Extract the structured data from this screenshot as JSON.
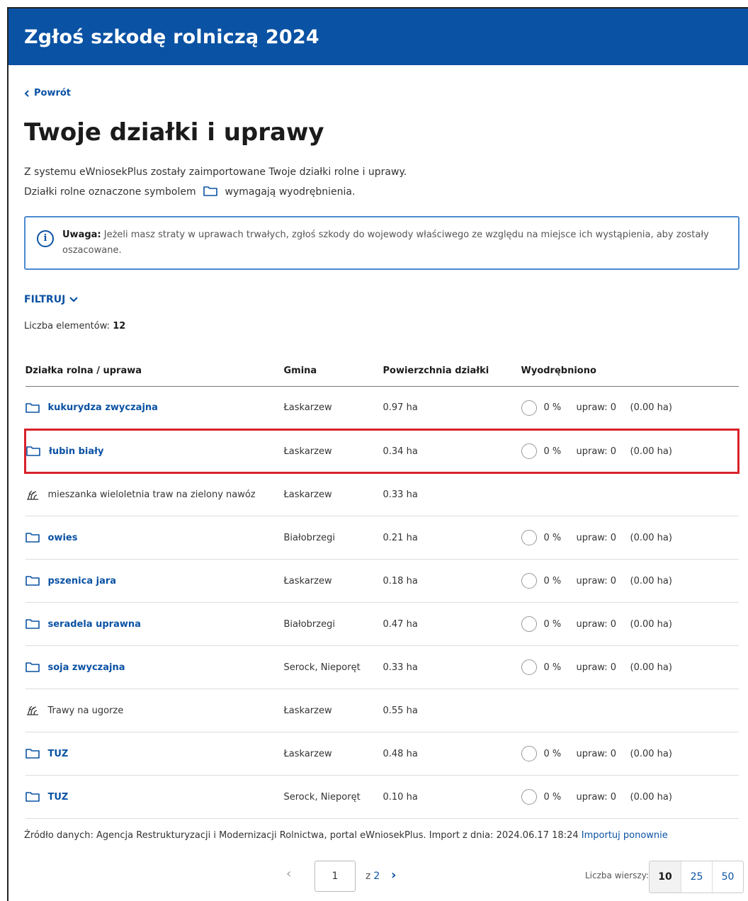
{
  "header": {
    "title": "Zgłoś szkodę rolniczą 2024"
  },
  "back": {
    "label": "Powrót"
  },
  "page_title": "Twoje działki i uprawy",
  "description": {
    "line1": "Z systemu eWniosekPlus zostały zaimportowane Twoje działki rolne i uprawy.",
    "line2_before": "Działki rolne oznaczone symbolem",
    "line2_after": "wymagają wyodrębnienia."
  },
  "alert": {
    "label": "Uwaga:",
    "text": " Jeżeli masz straty w uprawach trwałych, zgłoś szkody do wojewody właściwego ze względu na miejsce ich wystąpienia, aby zostały oszacowane."
  },
  "filter": {
    "label": "FILTRUJ"
  },
  "count": {
    "label": "Liczba elementów:",
    "value": "12"
  },
  "table": {
    "headers": [
      "Działka rolna / uprawa",
      "Gmina",
      "Powierzchnia działki",
      "Wyodrębniono"
    ],
    "rows": [
      {
        "name": "kukurydza zwyczajna",
        "gmina": "Łaskarzew",
        "area": "0.97 ha",
        "pct": "0 %",
        "upraw": "upraw: 0",
        "ha": "(0.00 ha)"
      },
      {
        "name": "łubin biały",
        "gmina": "Łaskarzew",
        "area": "0.34 ha",
        "pct": "0 %",
        "upraw": "upraw: 0",
        "ha": "(0.00 ha)"
      },
      {
        "name": "mieszanka wieloletnia traw na zielony nawóz",
        "gmina": "Łaskarzew",
        "area": "0.33 ha"
      },
      {
        "name": "owies",
        "gmina": "Białobrzegi",
        "area": "0.21 ha",
        "pct": "0 %",
        "upraw": "upraw: 0",
        "ha": "(0.00 ha)"
      },
      {
        "name": "pszenica jara",
        "gmina": "Łaskarzew",
        "area": "0.18 ha",
        "pct": "0 %",
        "upraw": "upraw: 0",
        "ha": "(0.00 ha)"
      },
      {
        "name": "seradela uprawna",
        "gmina": "Białobrzegi",
        "area": "0.47 ha",
        "pct": "0 %",
        "upraw": "upraw: 0",
        "ha": "(0.00 ha)"
      },
      {
        "name": "soja zwyczajna",
        "gmina": "Serock, Nieporęt",
        "area": "0.33 ha",
        "pct": "0 %",
        "upraw": "upraw: 0",
        "ha": "(0.00 ha)"
      },
      {
        "name": "Trawy na ugorze",
        "gmina": "Łaskarzew",
        "area": "0.55 ha"
      },
      {
        "name": "TUZ",
        "gmina": "Łaskarzew",
        "area": "0.48 ha",
        "pct": "0 %",
        "upraw": "upraw: 0",
        "ha": "(0.00 ha)"
      },
      {
        "name": "TUZ",
        "gmina": "Serock, Nieporęt",
        "area": "0.10 ha",
        "pct": "0 %",
        "upraw": "upraw: 0",
        "ha": "(0.00 ha)"
      }
    ]
  },
  "source": {
    "text": "Źródło danych: Agencja Restrukturyzacji i Modernizacji Rolnictwa, portal eWniosekPlus. Import z dnia: 2024.06.17 18:24",
    "link": "Importuj ponownie"
  },
  "pagination": {
    "current": "1",
    "of": "z",
    "total": "2",
    "rows_label": "Liczba wierszy:",
    "rows_options": [
      "10",
      "25",
      "50"
    ]
  }
}
